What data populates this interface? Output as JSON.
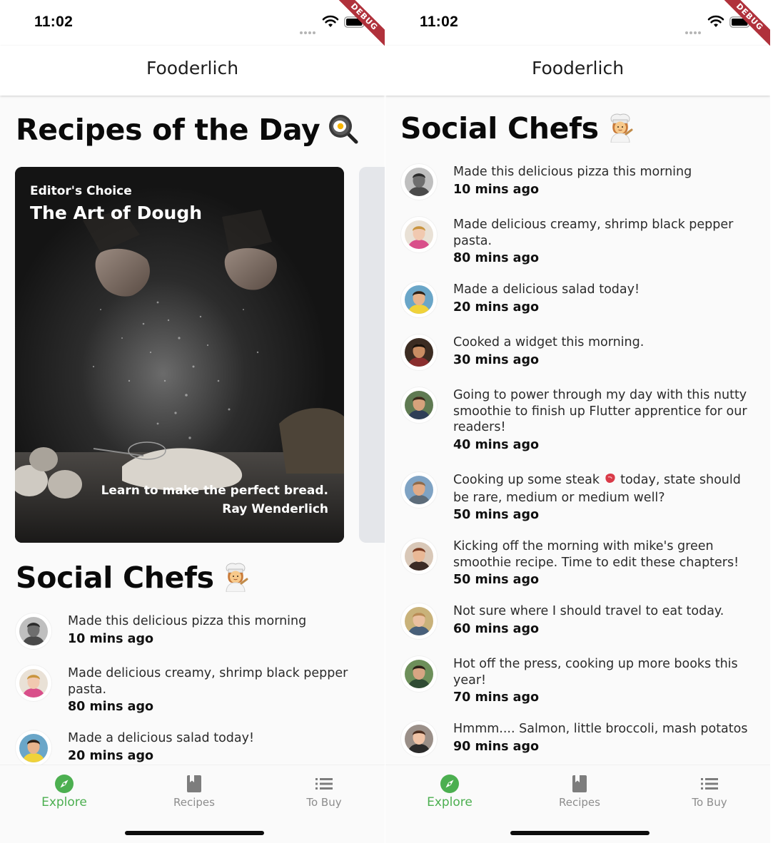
{
  "status": {
    "time": "11:02",
    "debug_label": "DEBUG"
  },
  "app": {
    "title": "Fooderlich",
    "accent_color": "#4caf50"
  },
  "explore": {
    "recipes_title": "Recipes of the Day",
    "recipes_emoji": "frying-pan-icon",
    "featured_card": {
      "category": "Editor's Choice",
      "title": "The Art of Dough",
      "description": "Learn to make the perfect bread.",
      "author": "Ray Wenderlich"
    },
    "social_title": "Social Chefs",
    "social_emoji": "cook-icon"
  },
  "friend_posts": [
    {
      "message": "Made this delicious pizza this morning",
      "time": "10 mins ago"
    },
    {
      "message": "Made delicious creamy, shrimp black pepper pasta.",
      "time": "80 mins ago"
    },
    {
      "message": "Made a delicious salad today!",
      "time": "20 mins ago"
    },
    {
      "message": "Cooked a widget this morning.",
      "time": "30 mins ago"
    },
    {
      "message": "Going to power through my day with this nutty smoothie to finish up Flutter apprentice for our readers!",
      "time": "40 mins ago"
    },
    {
      "message_before": "Cooking up some steak ",
      "message_after": " today, state should be rare, medium or medium well?",
      "time": "50 mins ago"
    },
    {
      "message": "Kicking off the morning with mike's green smoothie recipe. Time to edit these chapters!",
      "time": "50 mins ago"
    },
    {
      "message": "Not sure where I should travel to eat today.",
      "time": "60 mins ago"
    },
    {
      "message": "Hot off the press, cooking up more books this year!",
      "time": "70 mins ago"
    },
    {
      "message": "Hmmm.... Salmon, little broccoli, mash potatos",
      "time": "90 mins ago"
    }
  ],
  "bottom_nav": {
    "items": [
      {
        "label": "Explore",
        "icon": "compass-icon",
        "active": true
      },
      {
        "label": "Recipes",
        "icon": "book-icon",
        "active": false
      },
      {
        "label": "To Buy",
        "icon": "list-icon",
        "active": false
      }
    ]
  }
}
